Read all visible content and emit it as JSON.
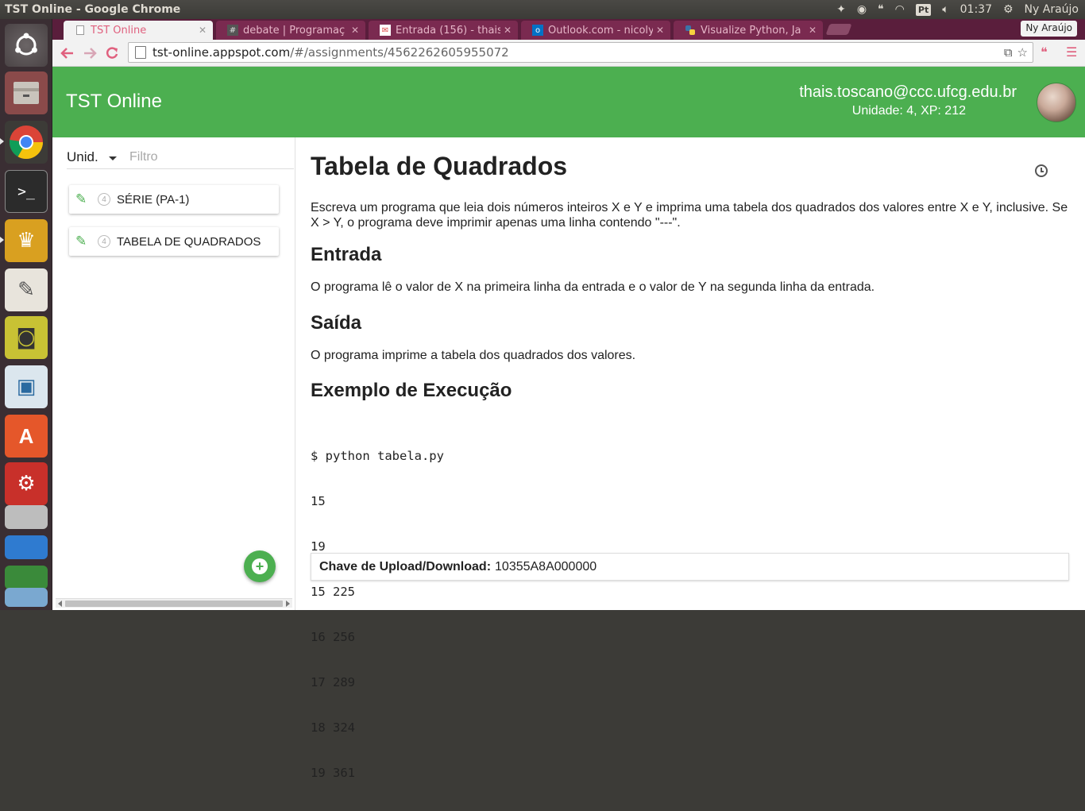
{
  "os_panel": {
    "window_title": "TST Online - Google Chrome",
    "clock": "01:37",
    "user": "Ny Araújo",
    "keyboard_layout": "Pt"
  },
  "browser": {
    "tabs": [
      {
        "label": "TST Online",
        "favicon": "page-icon",
        "active": true
      },
      {
        "label": "debate | Programaç",
        "favicon": "hash-icon",
        "active": false
      },
      {
        "label": "Entrada (156) - thais",
        "favicon": "gmail-icon",
        "active": false
      },
      {
        "label": "Outlook.com - nicoly",
        "favicon": "outlook-icon",
        "active": false
      },
      {
        "label": "Visualize Python, Ja",
        "favicon": "python-icon",
        "active": false
      }
    ],
    "profile_name": "Ny Araújo",
    "url_host": "tst-online.appspot.com",
    "url_path": "/#/assignments/4562262605955072"
  },
  "app": {
    "title": "TST Online",
    "user_email": "thais.toscano@ccc.ufcg.edu.br",
    "user_meta": "Unidade: 4, XP: 212",
    "accent_color": "#4caf50"
  },
  "sidebar": {
    "unit_select": "Unid.",
    "filter_placeholder": "Filtro",
    "assignments": [
      {
        "unit": "4",
        "name": "SÉRIE (PA-1)"
      },
      {
        "unit": "4",
        "name": "TABELA DE QUADRADOS"
      }
    ]
  },
  "assignment": {
    "title": "Tabela de Quadrados",
    "description": "Escreva um programa que leia dois números inteiros X e Y e imprima uma tabela dos quadrados dos valores entre X e Y, inclusive. Se X > Y, o programa deve imprimir apenas uma linha contendo \"---\".",
    "input_heading": "Entrada",
    "input_text": "O programa lê o valor de X na primeira linha da entrada e o valor de Y na segunda linha da entrada.",
    "output_heading": "Saída",
    "output_text": "O programa imprime a tabela dos quadrados dos valores.",
    "example_heading": "Exemplo de Execução",
    "example_lines": [
      "$ python tabela.py",
      "15",
      "19",
      "15 225",
      "16 256",
      "17 289",
      "18 324",
      "19 361"
    ],
    "key_label": "Chave de Upload/Download:",
    "key_value": "10355A8A000000"
  }
}
